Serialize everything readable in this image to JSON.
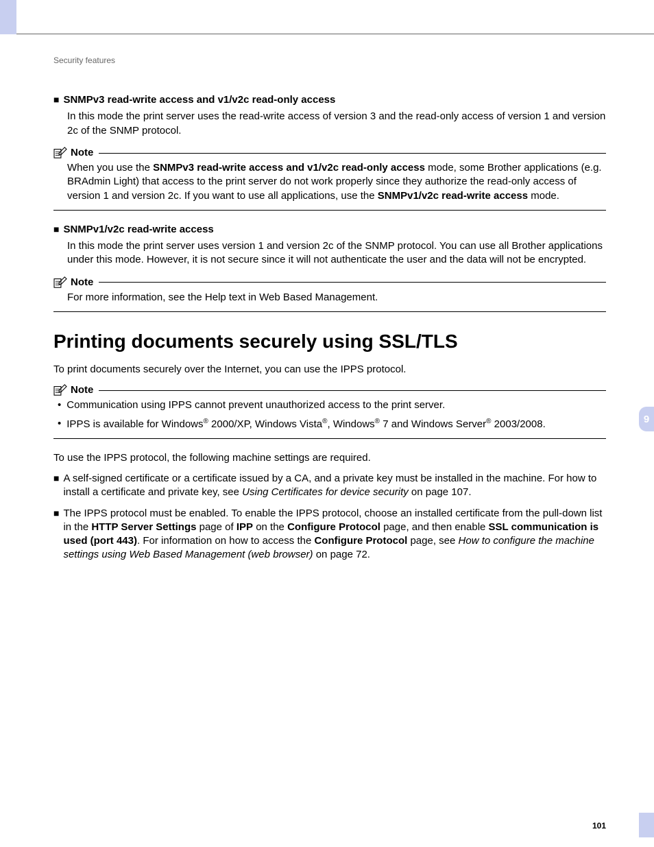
{
  "breadcrumb": "Security features",
  "section1": {
    "title": "SNMPv3 read-write access and v1/v2c read-only access",
    "body": "In this mode the print server uses the read-write access of version 3 and the read-only access of version 1 and version 2c of the SNMP protocol."
  },
  "note1": {
    "label": "Note",
    "t1": "When you use the ",
    "b1": "SNMPv3 read-write access and v1/v2c read-only access",
    "t2": " mode, some Brother applications (e.g. BRAdmin Light) that access to the print server do not work properly since they authorize the read-only access of version 1 and version 2c. If you want to use all applications, use the ",
    "b2": "SNMPv1/v2c read-write access",
    "t3": " mode."
  },
  "section2": {
    "title": "SNMPv1/v2c read-write access",
    "body": "In this mode the print server uses version 1 and version 2c of the SNMP protocol. You can use all Brother applications under this mode. However, it is not secure since it will not authenticate the user and the data will not be encrypted."
  },
  "note2": {
    "label": "Note",
    "body": "For more information, see the Help text in Web Based Management."
  },
  "heading": "Printing documents securely using SSL/TLS",
  "intro": "To print documents securely over the Internet, you can use the IPPS protocol.",
  "note3": {
    "label": "Note",
    "bullet1": "Communication using IPPS cannot prevent unauthorized access to the print server.",
    "b2a": "IPPS is available for Windows",
    "b2b": " 2000/XP, Windows Vista",
    "b2c": ", Windows",
    "b2d": " 7 and Windows Server",
    "b2e": " 2003/2008."
  },
  "intro2": "To use the IPPS protocol, the following machine settings are required.",
  "list1": {
    "t1": "A self-signed certificate or a certificate issued by a CA, and a private key must be installed in the machine. For how to install a certificate and private key, see ",
    "i1": "Using Certificates for device security",
    "t2": " on page 107."
  },
  "list2": {
    "t1": "The IPPS protocol must be enabled. To enable the IPPS protocol, choose an installed certificate from the pull-down list in the ",
    "b1": "HTTP Server Settings",
    "t2": " page of ",
    "b2": "IPP",
    "t3": " on the ",
    "b3": "Configure Protocol",
    "t4": " page, and then enable ",
    "b4": "SSL communication is used (port 443)",
    "t5": ". For information on how to access the ",
    "b5": "Configure Protocol",
    "t6": " page, see ",
    "i1": "How to configure the machine settings using Web Based Management (web browser)",
    "t7": " on page 72."
  },
  "chapter": "9",
  "pagenum": "101",
  "reg": "®"
}
